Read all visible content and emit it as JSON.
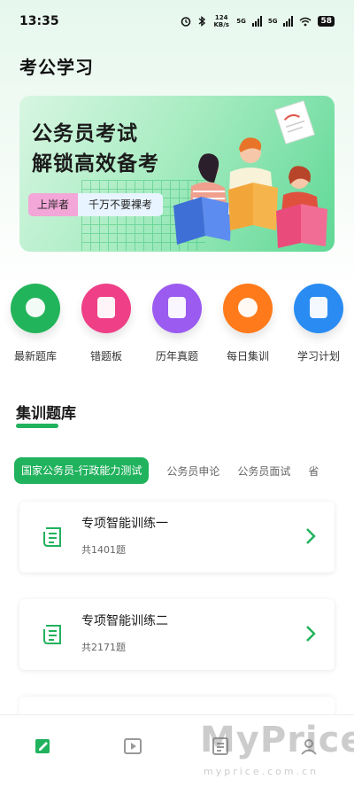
{
  "status_bar": {
    "time": "13:35",
    "net_speed": "124 KB/s",
    "net_type_1": "5G",
    "net_type_2": "5G",
    "battery": "58"
  },
  "app": {
    "title": "考公学习"
  },
  "banner": {
    "line1": "公务员考试",
    "line2": "解锁高效备考",
    "chip_left": "上岸者",
    "chip_right": "千万不要裸考"
  },
  "quick_actions": [
    {
      "label": "最新题库",
      "color": "#22b45a",
      "icon": "chat-icon"
    },
    {
      "label": "错题板",
      "color": "#ef3f86",
      "icon": "video-icon"
    },
    {
      "label": "历年真题",
      "color": "#9b5bf0",
      "icon": "document-icon"
    },
    {
      "label": "每日集训",
      "color": "#ff7a1a",
      "icon": "message-icon"
    },
    {
      "label": "学习计划",
      "color": "#2a8cf2",
      "icon": "bookmark-icon"
    }
  ],
  "section": {
    "title": "集训题库"
  },
  "tabs": [
    {
      "label": "国家公务员-行政能力测试",
      "active": true
    },
    {
      "label": "公务员申论",
      "active": false
    },
    {
      "label": "公务员面试",
      "active": false
    },
    {
      "label": "省",
      "active": false
    }
  ],
  "cards": [
    {
      "title": "专项智能训练一",
      "count": "共1401题"
    },
    {
      "title": "专项智能训练二",
      "count": "共2171题"
    }
  ],
  "bottom_nav": [
    {
      "icon": "edit-icon",
      "active": true
    },
    {
      "icon": "play-icon",
      "active": false
    },
    {
      "icon": "list-icon",
      "active": false
    },
    {
      "icon": "profile-icon",
      "active": false
    }
  ],
  "watermark": {
    "text": "MyPrice",
    "sub": "myprice.com.cn"
  },
  "colors": {
    "accent": "#21b25d"
  }
}
